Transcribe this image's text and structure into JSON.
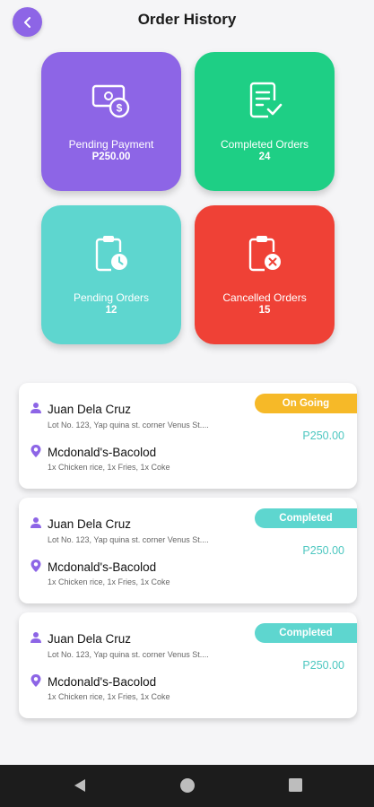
{
  "header": {
    "title": "Order History"
  },
  "tiles": [
    {
      "label": "Pending Payment",
      "value": "P250.00",
      "color": "#8d65e6",
      "icon": "cash-icon"
    },
    {
      "label": "Completed Orders",
      "value": "24",
      "color": "#1ecf85",
      "icon": "checklist-icon"
    },
    {
      "label": "Pending Orders",
      "value": "12",
      "color": "#5ed6cf",
      "icon": "clipboard-clock-icon"
    },
    {
      "label": "Cancelled Orders",
      "value": "15",
      "color": "#ef4136",
      "icon": "clipboard-cancel-icon"
    }
  ],
  "orders": [
    {
      "status": "On Going",
      "status_color": "#f6b928",
      "customer": "Juan Dela Cruz",
      "address": "Lot No. 123, Yap quina st. corner Venus St....",
      "price": "P250.00",
      "store": "Mcdonald's-Bacolod",
      "items": "1x Chicken rice, 1x Fries, 1x Coke"
    },
    {
      "status": "Completed",
      "status_color": "#5ed6cf",
      "customer": "Juan Dela Cruz",
      "address": "Lot No. 123, Yap quina st. corner Venus St....",
      "price": "P250.00",
      "store": "Mcdonald's-Bacolod",
      "items": "1x Chicken rice, 1x Fries, 1x Coke"
    },
    {
      "status": "Completed",
      "status_color": "#5ed6cf",
      "customer": "Juan Dela Cruz",
      "address": "Lot No. 123, Yap quina st. corner Venus St....",
      "price": "P250.00",
      "store": "Mcdonald's-Bacolod",
      "items": "1x Chicken rice, 1x Fries, 1x Coke"
    }
  ],
  "nav": {
    "back": "back-triangle-icon",
    "home": "home-circle-icon",
    "recents": "recents-square-icon"
  }
}
